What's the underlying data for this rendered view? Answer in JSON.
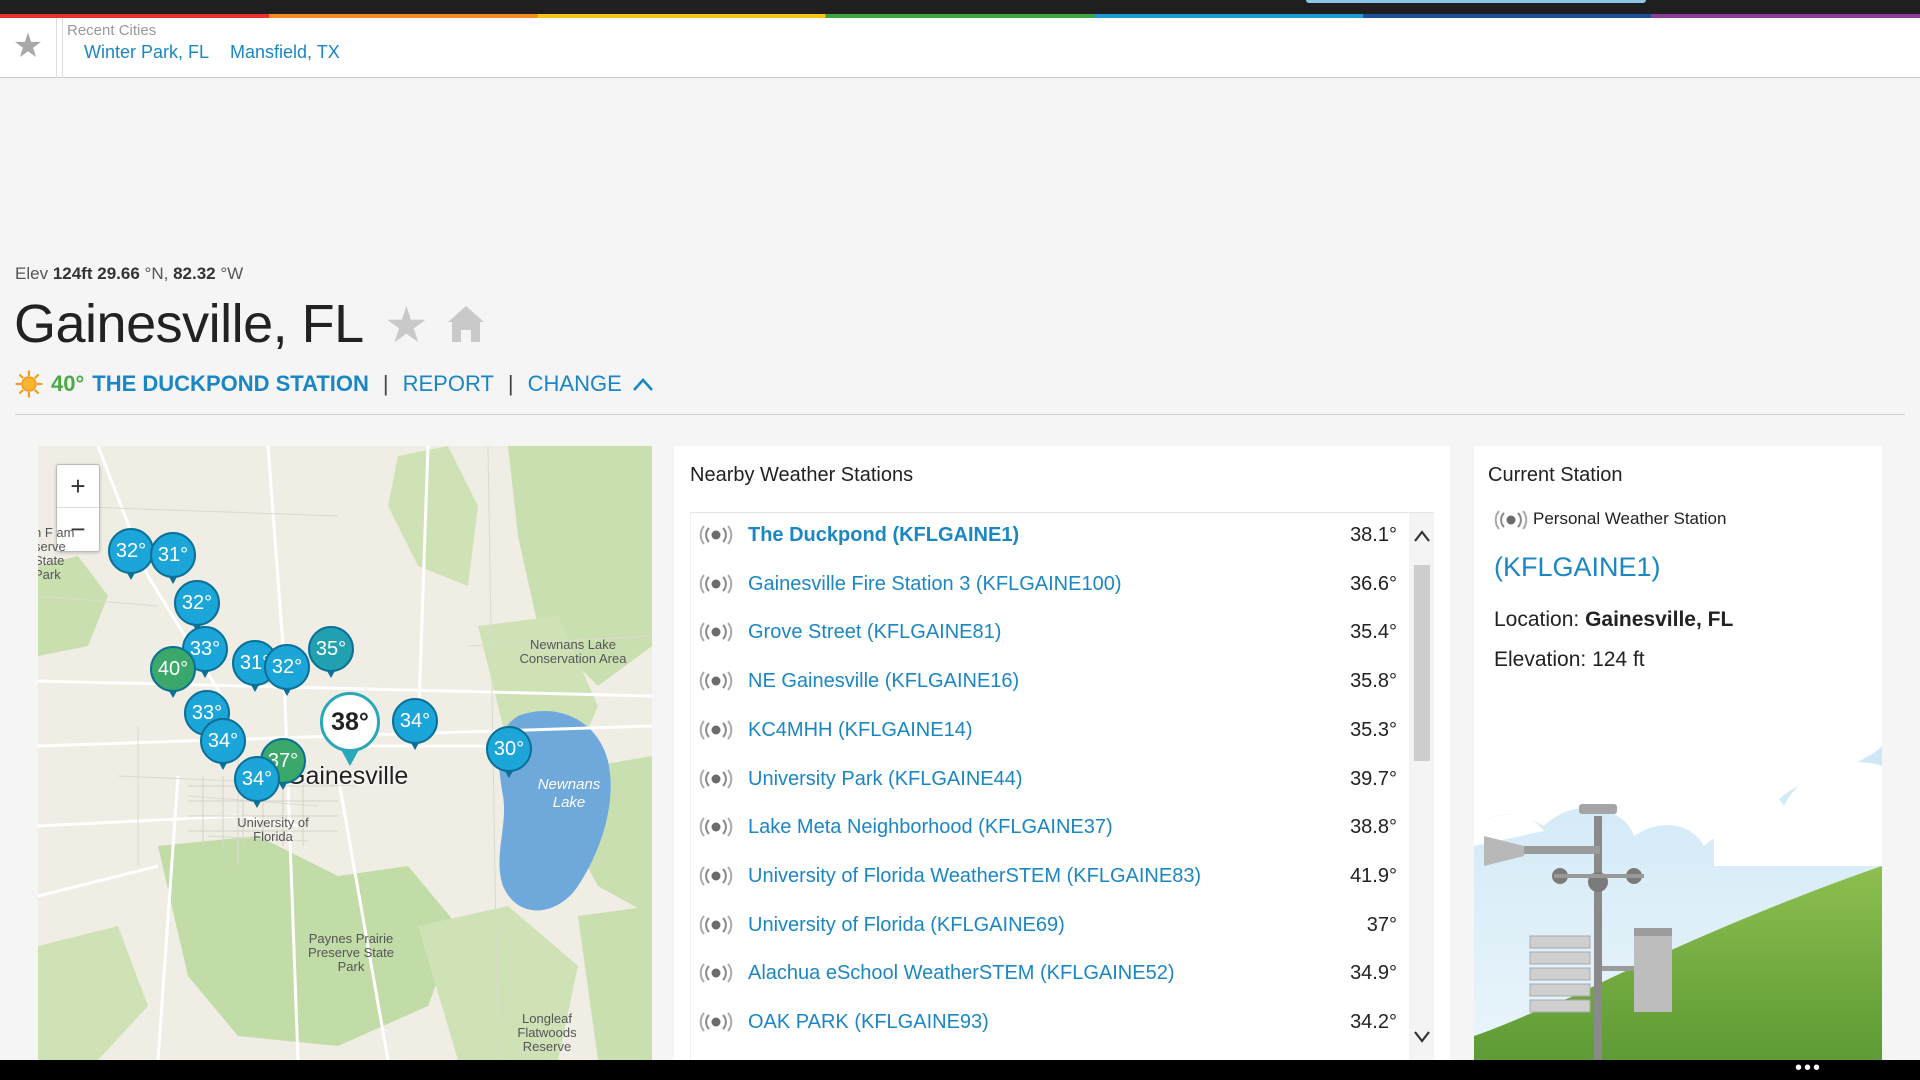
{
  "recent": {
    "label": "Recent Cities",
    "cities": [
      "Winter Park, FL",
      "Mansfield, TX"
    ]
  },
  "location": {
    "elev_label": "Elev",
    "elev_value": "124ft",
    "lat_value": "29.66",
    "lat_unit": "°N,",
    "lon_value": "82.32",
    "lon_unit": "°W",
    "city": "Gainesville, FL"
  },
  "station_bar": {
    "temp": "40°",
    "name": "THE DUCKPOND STATION",
    "separator": "|",
    "report_label": "REPORT",
    "change_label": "CHANGE"
  },
  "map": {
    "zoom_in": "+",
    "zoom_out": "−",
    "city_label": "Gainesville",
    "big_pin_temp": "38°",
    "labels": {
      "newnans_area": "Newnans Lake Conservation Area",
      "newnans_lake": "Newnans Lake",
      "university": "University of Florida",
      "paynes": "Paynes Prairie Preserve State Park",
      "longleaf": "Longleaf Flatwoods Reserve",
      "left_park": "n F am serve State Park"
    },
    "pins": [
      {
        "temp": "32°",
        "color": "#1ca5d8"
      },
      {
        "temp": "31°",
        "color": "#1ca5d8"
      },
      {
        "temp": "32°",
        "color": "#1ca5d8"
      },
      {
        "temp": "33°",
        "color": "#1ca5d8"
      },
      {
        "temp": "35°",
        "color": "#20a0b0"
      },
      {
        "temp": "31°",
        "color": "#1ca5d8"
      },
      {
        "temp": "32°",
        "color": "#1ca5d8"
      },
      {
        "temp": "40°",
        "color": "#3aa86a"
      },
      {
        "temp": "33°",
        "color": "#1ca5d8"
      },
      {
        "temp": "34°",
        "color": "#1ca5d8"
      },
      {
        "temp": "37°",
        "color": "#3aa86a"
      },
      {
        "temp": "34°",
        "color": "#1ca5d8"
      },
      {
        "temp": "34°",
        "color": "#1ca5d8"
      },
      {
        "temp": "30°",
        "color": "#1ca5d8"
      }
    ]
  },
  "nearby": {
    "title": "Nearby Weather Stations",
    "stations": [
      {
        "name": "The Duckpond (KFLGAINE1)",
        "temp": "38.1°"
      },
      {
        "name": "Gainesville Fire Station 3 (KFLGAINE100)",
        "temp": "36.6°"
      },
      {
        "name": "Grove Street (KFLGAINE81)",
        "temp": "35.4°"
      },
      {
        "name": "NE Gainesville (KFLGAINE16)",
        "temp": "35.8°"
      },
      {
        "name": "KC4MHH (KFLGAINE14)",
        "temp": "35.3°"
      },
      {
        "name": "University Park (KFLGAINE44)",
        "temp": "39.7°"
      },
      {
        "name": "Lake Meta Neighborhood (KFLGAINE37)",
        "temp": "38.8°"
      },
      {
        "name": "University of Florida WeatherSTEM (KFLGAINE83)",
        "temp": "41.9°"
      },
      {
        "name": "University of Florida (KFLGAINE69)",
        "temp": "37°"
      },
      {
        "name": "Alachua eSchool WeatherSTEM (KFLGAINE52)",
        "temp": "34.9°"
      },
      {
        "name": "OAK PARK (KFLGAINE93)",
        "temp": "34.2°"
      }
    ]
  },
  "current": {
    "title": "Current Station",
    "type": "Personal Weather Station",
    "id": "(KFLGAINE1)",
    "location_label": "Location:",
    "location_value": "Gainesville, FL",
    "elevation_label": "Elevation:",
    "elevation_value": "124 ft"
  },
  "taskbar": {
    "dots": "•••"
  },
  "colors": {
    "link": "#1b86c4",
    "temp_green": "#4aaa46",
    "pin_blue": "#1ca5d8",
    "pin_green": "#3aa86a"
  }
}
